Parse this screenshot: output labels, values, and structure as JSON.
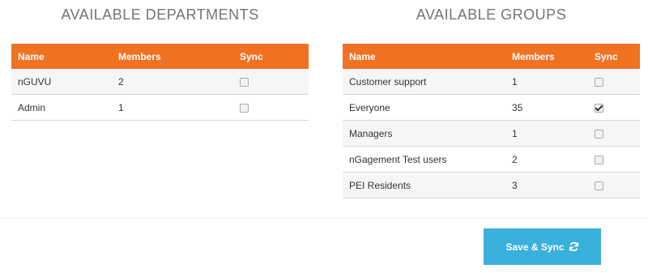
{
  "departments": {
    "title": "AVAILABLE DEPARTMENTS",
    "headers": {
      "name": "Name",
      "members": "Members",
      "sync": "Sync"
    },
    "rows": [
      {
        "name": "nGUVU",
        "members": "2",
        "sync": false
      },
      {
        "name": "Admin",
        "members": "1",
        "sync": false
      }
    ]
  },
  "groups": {
    "title": "AVAILABLE GROUPS",
    "headers": {
      "name": "Name",
      "members": "Members",
      "sync": "Sync"
    },
    "rows": [
      {
        "name": "Customer support",
        "members": "1",
        "sync": false
      },
      {
        "name": "Everyone",
        "members": "35",
        "sync": true
      },
      {
        "name": "Managers",
        "members": "1",
        "sync": false
      },
      {
        "name": "nGagement Test users",
        "members": "2",
        "sync": false
      },
      {
        "name": "PEI Residents",
        "members": "3",
        "sync": false
      }
    ]
  },
  "actions": {
    "save_sync_label": "Save & Sync",
    "save_sync_icon": "sync-icon"
  },
  "colors": {
    "header_bg": "#f07122",
    "button_bg": "#3ab0dc",
    "title_text": "#757575"
  }
}
